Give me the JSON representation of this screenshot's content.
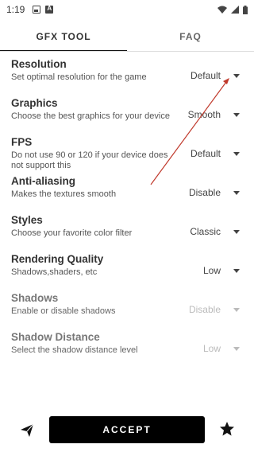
{
  "status_bar": {
    "time": "1:19"
  },
  "tabs": [
    {
      "label": "GFX TOOL",
      "active": true
    },
    {
      "label": "FAQ",
      "active": false
    }
  ],
  "settings": [
    {
      "label": "Resolution",
      "description": "Set optimal resolution for the game",
      "value": "Default",
      "enabled": true
    },
    {
      "label": "Graphics",
      "description": "Choose the best graphics for your device",
      "value": "Smooth",
      "enabled": true
    },
    {
      "label": "FPS",
      "description": "Do not use 90 or 120 if your device does not support this",
      "value": "Default",
      "enabled": true
    },
    {
      "label": "Anti-aliasing",
      "description": "Makes the textures smooth",
      "value": "Disable",
      "enabled": true
    },
    {
      "label": "Styles",
      "description": "Choose your favorite color filter",
      "value": "Classic",
      "enabled": true
    },
    {
      "label": "Rendering Quality",
      "description": "Shadows,shaders, etc",
      "value": "Low",
      "enabled": true
    },
    {
      "label": "Shadows",
      "description": "Enable or disable shadows",
      "value": "Disable",
      "enabled": false
    },
    {
      "label": "Shadow Distance",
      "description": "Select the shadow distance level",
      "value": "Low",
      "enabled": false
    }
  ],
  "bottom_bar": {
    "accept_label": "ACCEPT"
  },
  "colors": {
    "accent": "#000000",
    "annotation": "#c0392b",
    "disabled": "#bbbbbb"
  },
  "icons": [
    "image-icon",
    "font-icon",
    "wifi-icon",
    "signal-icon",
    "battery-icon",
    "send-icon",
    "star-icon",
    "dropdown-caret-icon"
  ]
}
